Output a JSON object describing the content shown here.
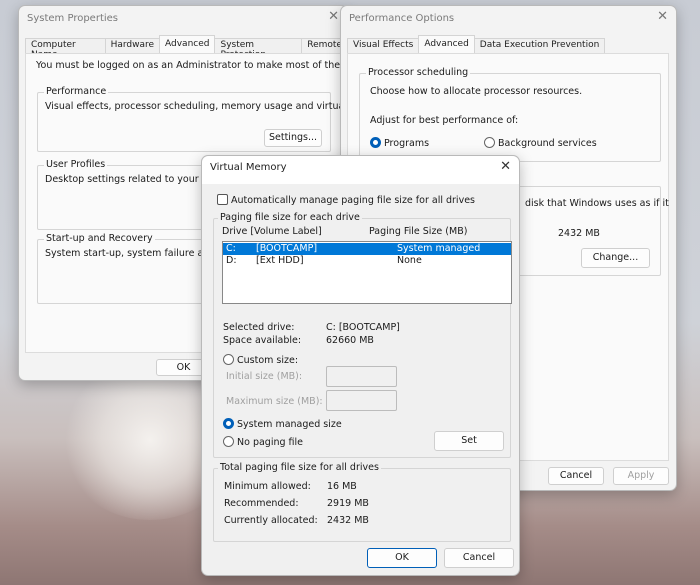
{
  "system_properties": {
    "title": "System Properties",
    "tabs": [
      "Computer Name",
      "Hardware",
      "Advanced",
      "System Protection",
      "Remote"
    ],
    "active_tab": "Advanced",
    "admin_note": "You must be logged on as an Administrator to make most of these changes.",
    "performance": {
      "label": "Performance",
      "desc": "Visual effects, processor scheduling, memory usage and virtual memory",
      "button": "Settings..."
    },
    "user_profiles": {
      "label": "User Profiles",
      "desc": "Desktop settings related to your sign-in"
    },
    "startup": {
      "label": "Start-up and Recovery",
      "desc": "System start-up, system failure and debugging information"
    },
    "ok": "OK"
  },
  "performance_options": {
    "title": "Performance Options",
    "tabs": [
      "Visual Effects",
      "Advanced",
      "Data Execution Prevention"
    ],
    "active_tab": "Advanced",
    "processor": {
      "label": "Processor scheduling",
      "desc": "Choose how to allocate processor resources.",
      "adjust": "Adjust for best performance of:",
      "options": [
        "Programs",
        "Background services"
      ],
      "selected": "Programs"
    },
    "virtual_memory": {
      "desc": "disk that Windows uses as if it",
      "size": "2432 MB",
      "button": "Change..."
    },
    "cancel": "Cancel",
    "apply": "Apply"
  },
  "virtual_memory": {
    "title": "Virtual Memory",
    "auto_manage": {
      "label": "Automatically manage paging file size for all drives",
      "checked": false
    },
    "group_label": "Paging file size for each drive",
    "col_drive": "Drive  [Volume Label]",
    "col_size": "Paging File Size (MB)",
    "drives": [
      {
        "letter": "C:",
        "label": "[BOOTCAMP]",
        "size": "System managed",
        "selected": true
      },
      {
        "letter": "D:",
        "label": "[Ext HDD]",
        "size": "None",
        "selected": false
      }
    ],
    "selected_drive_label": "Selected drive:",
    "selected_drive": "C:  [BOOTCAMP]",
    "space_label": "Space available:",
    "space": "62660 MB",
    "custom_size": "Custom size:",
    "initial_size": "Initial size (MB):",
    "maximum_size": "Maximum size (MB):",
    "system_managed": "System managed size",
    "no_paging": "No paging file",
    "selected_option": "System managed size",
    "set": "Set",
    "totals_label": "Total paging file size for all drives",
    "min_label": "Minimum allowed:",
    "min": "16 MB",
    "rec_label": "Recommended:",
    "rec": "2919 MB",
    "cur_label": "Currently allocated:",
    "cur": "2432 MB",
    "ok": "OK",
    "cancel": "Cancel"
  },
  "colors": {
    "accent": "#005fb8",
    "selection": "#0078d7"
  }
}
